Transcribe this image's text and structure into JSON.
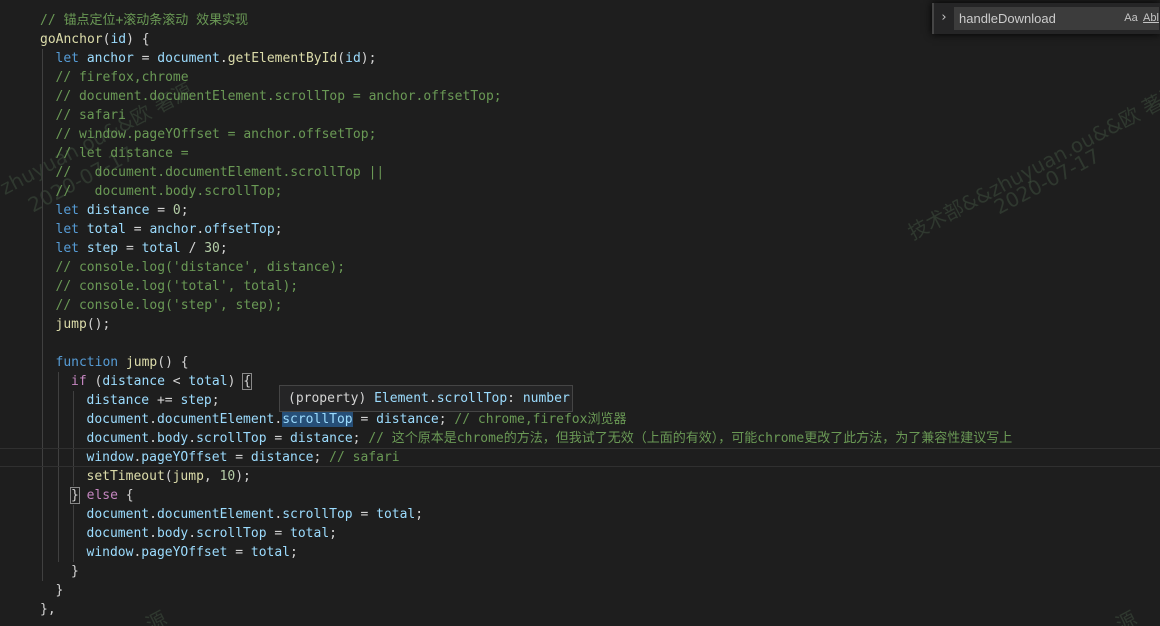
{
  "find_widget": {
    "toggle_icon": "chevron-right-icon",
    "query": "handleDownload",
    "match_case_label": "Aa",
    "whole_word_label": "Abl"
  },
  "hover_tooltip": [
    {
      "t": "(property) ",
      "c": "op"
    },
    {
      "t": "Element",
      "c": "var"
    },
    {
      "t": ".",
      "c": "op"
    },
    {
      "t": "scrollTop",
      "c": "var"
    },
    {
      "t": ": ",
      "c": "op"
    },
    {
      "t": "number",
      "c": "var"
    }
  ],
  "watermarks": [
    {
      "text": "zhuyuan.ou&&欧 著源"
    },
    {
      "text": "2020-07-17"
    },
    {
      "text": "技术部&&zhuyuan.ou&&欧 著源"
    },
    {
      "text": "2020-07-17"
    },
    {
      "text": "源"
    },
    {
      "text": "源"
    }
  ],
  "code_lines": [
    [
      {
        "t": "// 锚点定位+滚动条滚动 效果实现",
        "c": "com"
      }
    ],
    [
      {
        "t": "goAnchor",
        "c": "fn"
      },
      {
        "t": "(",
        "c": "op"
      },
      {
        "t": "id",
        "c": "var"
      },
      {
        "t": ") {",
        "c": "op"
      }
    ],
    [
      {
        "t": "let",
        "c": "kw"
      },
      {
        "t": " ",
        "c": "op"
      },
      {
        "t": "anchor",
        "c": "var"
      },
      {
        "t": " = ",
        "c": "op"
      },
      {
        "t": "document",
        "c": "var"
      },
      {
        "t": ".",
        "c": "op"
      },
      {
        "t": "getElementById",
        "c": "fn"
      },
      {
        "t": "(",
        "c": "op"
      },
      {
        "t": "id",
        "c": "var"
      },
      {
        "t": ");",
        "c": "op"
      }
    ],
    [
      {
        "t": "// firefox,chrome",
        "c": "com"
      }
    ],
    [
      {
        "t": "// document.documentElement.scrollTop = anchor.offsetTop;",
        "c": "com"
      }
    ],
    [
      {
        "t": "// safari",
        "c": "com"
      }
    ],
    [
      {
        "t": "// window.pageYOffset = anchor.offsetTop;",
        "c": "com"
      }
    ],
    [
      {
        "t": "// let distance =",
        "c": "com"
      }
    ],
    [
      {
        "t": "//   document.documentElement.scrollTop ||",
        "c": "com"
      }
    ],
    [
      {
        "t": "//   document.body.scrollTop;",
        "c": "com"
      }
    ],
    [
      {
        "t": "let",
        "c": "kw"
      },
      {
        "t": " ",
        "c": "op"
      },
      {
        "t": "distance",
        "c": "var"
      },
      {
        "t": " = ",
        "c": "op"
      },
      {
        "t": "0",
        "c": "num"
      },
      {
        "t": ";",
        "c": "op"
      }
    ],
    [
      {
        "t": "let",
        "c": "kw"
      },
      {
        "t": " ",
        "c": "op"
      },
      {
        "t": "total",
        "c": "var"
      },
      {
        "t": " = ",
        "c": "op"
      },
      {
        "t": "anchor",
        "c": "var"
      },
      {
        "t": ".",
        "c": "op"
      },
      {
        "t": "offsetTop",
        "c": "var"
      },
      {
        "t": ";",
        "c": "op"
      }
    ],
    [
      {
        "t": "let",
        "c": "kw"
      },
      {
        "t": " ",
        "c": "op"
      },
      {
        "t": "step",
        "c": "var"
      },
      {
        "t": " = ",
        "c": "op"
      },
      {
        "t": "total",
        "c": "var"
      },
      {
        "t": " / ",
        "c": "op"
      },
      {
        "t": "30",
        "c": "num"
      },
      {
        "t": ";",
        "c": "op"
      }
    ],
    [
      {
        "t": "// console.log('distance', distance);",
        "c": "com"
      }
    ],
    [
      {
        "t": "// console.log('total', total);",
        "c": "com"
      }
    ],
    [
      {
        "t": "// console.log('step', step);",
        "c": "com"
      }
    ],
    [
      {
        "t": "jump",
        "c": "fn"
      },
      {
        "t": "();",
        "c": "op"
      }
    ],
    [],
    [
      {
        "t": "function",
        "c": "kw"
      },
      {
        "t": " ",
        "c": "op"
      },
      {
        "t": "jump",
        "c": "fn"
      },
      {
        "t": "() {",
        "c": "op"
      }
    ],
    [
      {
        "t": "if",
        "c": "ctl"
      },
      {
        "t": " (",
        "c": "op"
      },
      {
        "t": "distance",
        "c": "var"
      },
      {
        "t": " < ",
        "c": "op"
      },
      {
        "t": "total",
        "c": "var"
      },
      {
        "t": ") ",
        "c": "op"
      },
      {
        "t": "{",
        "c": "op",
        "hl": "bracket"
      }
    ],
    [
      {
        "t": "distance",
        "c": "var"
      },
      {
        "t": " += ",
        "c": "op"
      },
      {
        "t": "step",
        "c": "var"
      },
      {
        "t": ";",
        "c": "op"
      }
    ],
    [
      {
        "t": "document",
        "c": "var"
      },
      {
        "t": ".",
        "c": "op"
      },
      {
        "t": "documentElement",
        "c": "var"
      },
      {
        "t": ".",
        "c": "op"
      },
      {
        "t": "scrollTop",
        "c": "var",
        "hl": "word"
      },
      {
        "t": " = ",
        "c": "op"
      },
      {
        "t": "distance",
        "c": "var"
      },
      {
        "t": "; ",
        "c": "op"
      },
      {
        "t": "// chrome,firefox浏览器",
        "c": "com"
      }
    ],
    [
      {
        "t": "document",
        "c": "var"
      },
      {
        "t": ".",
        "c": "op"
      },
      {
        "t": "body",
        "c": "var"
      },
      {
        "t": ".",
        "c": "op"
      },
      {
        "t": "scrollTop",
        "c": "var"
      },
      {
        "t": " = ",
        "c": "op"
      },
      {
        "t": "distance",
        "c": "var"
      },
      {
        "t": "; ",
        "c": "op"
      },
      {
        "t": "// 这个原本是chrome的方法，但我试了无效（上面的有效），可能chrome更改了此方法，为了兼容性建议写上",
        "c": "com"
      }
    ],
    [
      {
        "t": "window",
        "c": "var"
      },
      {
        "t": ".",
        "c": "op"
      },
      {
        "t": "pageYOffset",
        "c": "var"
      },
      {
        "t": " = ",
        "c": "op"
      },
      {
        "t": "distance",
        "c": "var"
      },
      {
        "t": "; ",
        "c": "op"
      },
      {
        "t": "// safari",
        "c": "com"
      }
    ],
    [
      {
        "t": "setTimeout",
        "c": "fn"
      },
      {
        "t": "(",
        "c": "op"
      },
      {
        "t": "jump",
        "c": "fn"
      },
      {
        "t": ", ",
        "c": "op"
      },
      {
        "t": "10",
        "c": "num"
      },
      {
        "t": ");",
        "c": "op"
      }
    ],
    [
      {
        "t": "}",
        "c": "op",
        "hl": "bracket"
      },
      {
        "t": " ",
        "c": "op"
      },
      {
        "t": "else",
        "c": "ctl"
      },
      {
        "t": " {",
        "c": "op"
      }
    ],
    [
      {
        "t": "document",
        "c": "var"
      },
      {
        "t": ".",
        "c": "op"
      },
      {
        "t": "documentElement",
        "c": "var"
      },
      {
        "t": ".",
        "c": "op"
      },
      {
        "t": "scrollTop",
        "c": "var"
      },
      {
        "t": " = ",
        "c": "op"
      },
      {
        "t": "total",
        "c": "var"
      },
      {
        "t": ";",
        "c": "op"
      }
    ],
    [
      {
        "t": "document",
        "c": "var"
      },
      {
        "t": ".",
        "c": "op"
      },
      {
        "t": "body",
        "c": "var"
      },
      {
        "t": ".",
        "c": "op"
      },
      {
        "t": "scrollTop",
        "c": "var"
      },
      {
        "t": " = ",
        "c": "op"
      },
      {
        "t": "total",
        "c": "var"
      },
      {
        "t": ";",
        "c": "op"
      }
    ],
    [
      {
        "t": "window",
        "c": "var"
      },
      {
        "t": ".",
        "c": "op"
      },
      {
        "t": "pageYOffset",
        "c": "var"
      },
      {
        "t": " = ",
        "c": "op"
      },
      {
        "t": "total",
        "c": "var"
      },
      {
        "t": ";",
        "c": "op"
      }
    ],
    [
      {
        "t": "}",
        "c": "op"
      }
    ],
    [
      {
        "t": "}",
        "c": "op"
      }
    ],
    [
      {
        "t": "},",
        "c": "op"
      }
    ]
  ]
}
